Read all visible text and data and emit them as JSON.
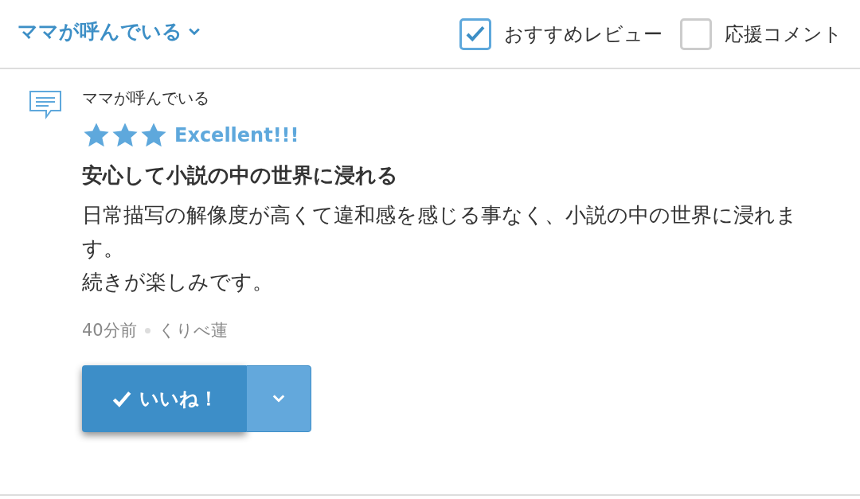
{
  "header": {
    "title": "ママが呼んでいる",
    "filters": [
      {
        "label": "おすすめレビュー",
        "checked": true
      },
      {
        "label": "応援コメント",
        "checked": false
      }
    ]
  },
  "review": {
    "work_title": "ママが呼んでいる",
    "stars": 3,
    "rating_label": "Excellent!!!",
    "heading": "安心して小説の中の世界に浸れる",
    "body": [
      "日常描写の解像度が高くて違和感を感じる事なく、小説の中の世界に浸れます。",
      "続きが楽しみです。"
    ],
    "time": "40分前",
    "author": "くりべ蓮",
    "like_label": "いいね！",
    "liked": true
  }
}
